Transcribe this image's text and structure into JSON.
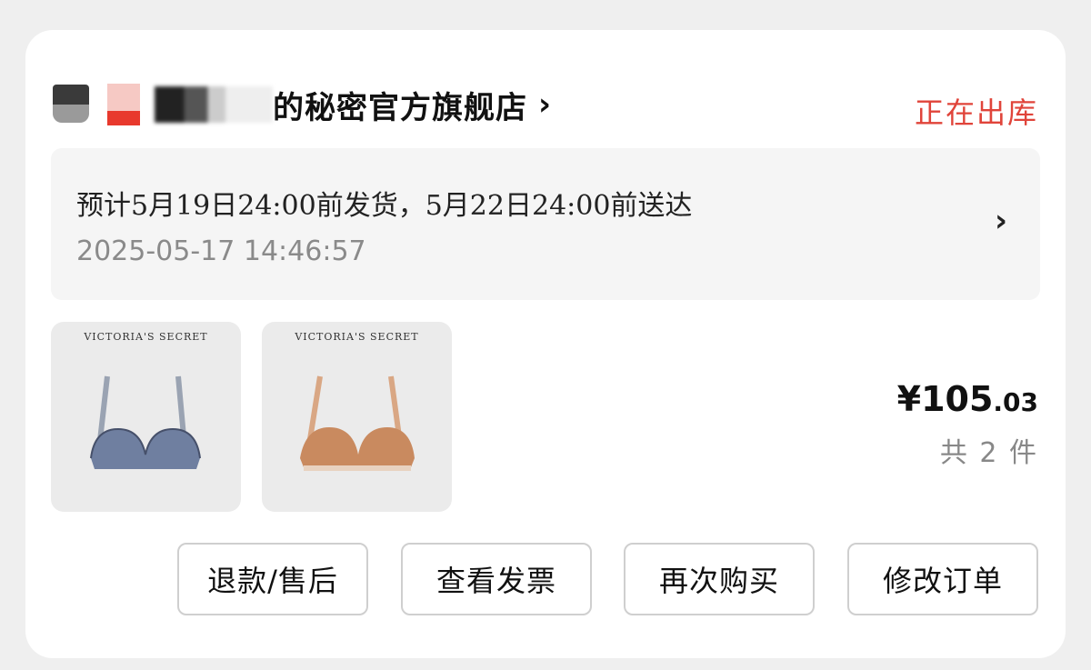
{
  "store": {
    "name": "的秘密官方旗舰店",
    "status": "正在出库"
  },
  "delivery": {
    "estimate": "预计5月19日24:00前发货，5月22日24:00前送达",
    "timestamp": "2025-05-17 14:46:57"
  },
  "products": [
    {
      "brand": "VICTORIA'S SECRET",
      "color": "#6f7fa0"
    },
    {
      "brand": "VICTORIA'S SECRET",
      "color": "#c98a5f"
    }
  ],
  "summary": {
    "price_main": "¥105",
    "price_cents": ".03",
    "count": "共 2 件"
  },
  "actions": [
    {
      "label": "退款/售后"
    },
    {
      "label": "查看发票"
    },
    {
      "label": "再次购买"
    },
    {
      "label": "修改订单"
    }
  ],
  "colors": {
    "status": "#e0443a",
    "background": "#efefef"
  }
}
